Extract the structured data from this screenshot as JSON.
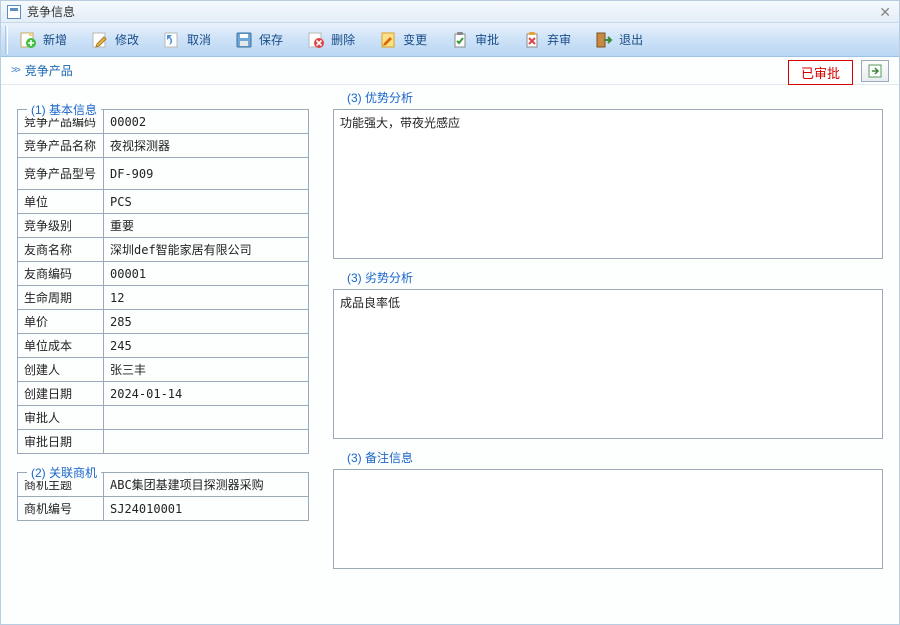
{
  "window": {
    "title": "竞争信息"
  },
  "toolbar": {
    "add": "新增",
    "edit": "修改",
    "cancel": "取消",
    "save": "保存",
    "delete": "删除",
    "change": "变更",
    "approve": "审批",
    "abandon": "弃审",
    "exit": "退出"
  },
  "crumb": "竞争产品",
  "status": "已审批",
  "groups": {
    "basic": "(1) 基本信息",
    "opp": "(2) 关联商机",
    "adv": "(3) 优势分析",
    "dis": "(3) 劣势分析",
    "note": "(3) 备注信息"
  },
  "basic": {
    "k_code": "竞争产品编码",
    "v_code": "00002",
    "k_name": "竞争产品名称",
    "v_name": "夜视探测器",
    "k_model": "竞争产品型号",
    "v_model": "DF-909",
    "k_unit": "单位",
    "v_unit": "PCS",
    "k_level": "竞争级别",
    "v_level": "重要",
    "k_vendor": "友商名称",
    "v_vendor": "深圳def智能家居有限公司",
    "k_vcode": "友商编码",
    "v_vcode": "00001",
    "k_life": "生命周期",
    "v_life": "12",
    "k_price": "单价",
    "v_price": "285",
    "k_cost": "单位成本",
    "v_cost": "245",
    "k_creator": "创建人",
    "v_creator": "张三丰",
    "k_cdate": "创建日期",
    "v_cdate": "2024-01-14",
    "k_approver": "审批人",
    "v_approver": "",
    "k_adate": "审批日期",
    "v_adate": ""
  },
  "opp": {
    "k_subject": "商机主题",
    "v_subject": "ABC集团基建项目探测器采购",
    "k_number": "商机编号",
    "v_number": "SJ24010001"
  },
  "adv_text": "功能强大，带夜光感应",
  "dis_text": "成品良率低",
  "note_text": ""
}
